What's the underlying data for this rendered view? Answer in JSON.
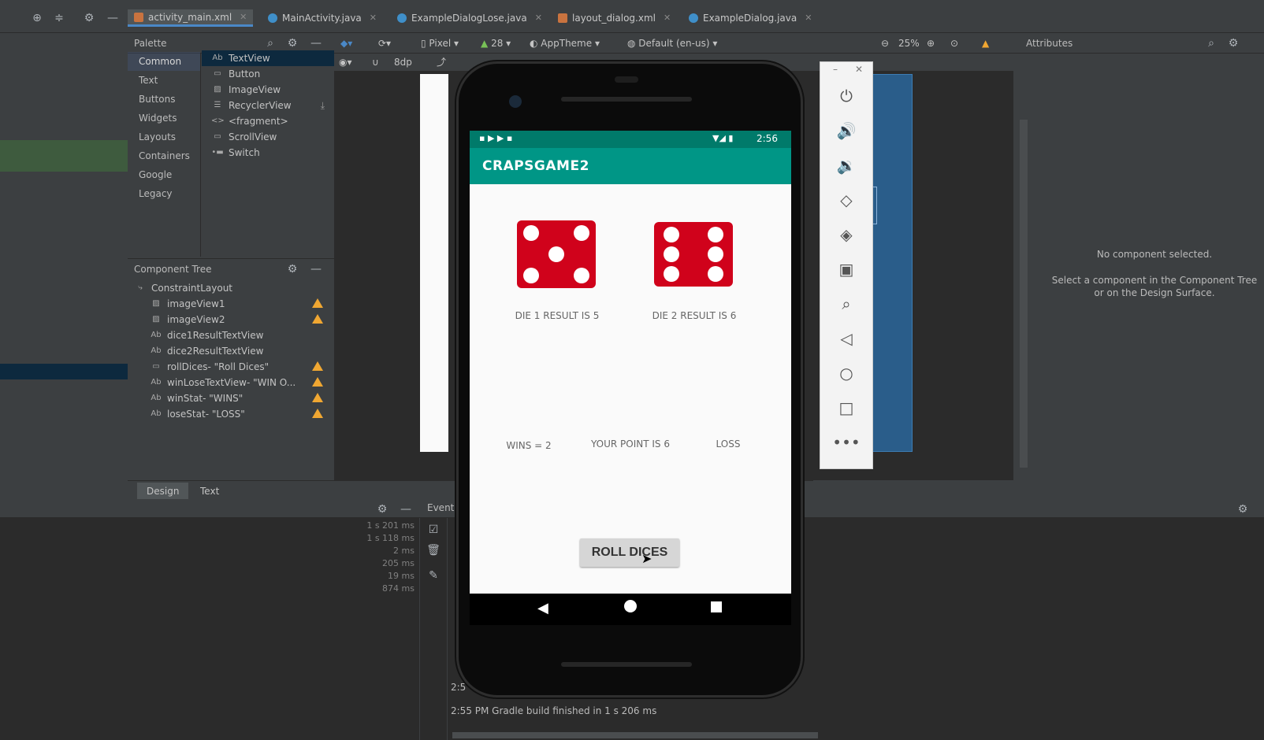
{
  "toolbar": {
    "icons": [
      "crosshair-icon",
      "collapse-icon",
      "gear-icon",
      "minimize-icon"
    ]
  },
  "tabs": [
    {
      "label": "activity_main.xml",
      "type": "xml",
      "active": true
    },
    {
      "label": "MainActivity.java",
      "type": "java",
      "active": false
    },
    {
      "label": "ExampleDialogLose.java",
      "type": "java",
      "active": false
    },
    {
      "label": "layout_dialog.xml",
      "type": "xml",
      "active": false
    },
    {
      "label": "ExampleDialog.java",
      "type": "java",
      "active": false
    }
  ],
  "palette": {
    "title": "Palette",
    "categories": [
      "Common",
      "Text",
      "Buttons",
      "Widgets",
      "Layouts",
      "Containers",
      "Google",
      "Legacy"
    ],
    "items": [
      {
        "glyph": "Ab",
        "label": "TextView"
      },
      {
        "glyph": "▭",
        "label": "Button"
      },
      {
        "glyph": "▨",
        "label": "ImageView"
      },
      {
        "glyph": "☰",
        "label": "RecyclerView"
      },
      {
        "glyph": "<>",
        "label": "<fragment>"
      },
      {
        "glyph": "▭",
        "label": "ScrollView"
      },
      {
        "glyph": "•▬",
        "label": "Switch"
      }
    ]
  },
  "design_toolbar": {
    "device": "Pixel",
    "api": "28",
    "theme": "AppTheme",
    "locale": "Default (en-us)",
    "zoom": "25%",
    "margin": "8dp"
  },
  "component_tree": {
    "title": "Component Tree",
    "root": "ConstraintLayout",
    "items": [
      {
        "glyph": "▨",
        "label": "imageView1",
        "warn": true
      },
      {
        "glyph": "▨",
        "label": "imageView2",
        "warn": true
      },
      {
        "glyph": "Ab",
        "label": "dice1ResultTextView",
        "warn": false
      },
      {
        "glyph": "Ab",
        "label": "dice2ResultTextView",
        "warn": false
      },
      {
        "glyph": "▭",
        "label": "rollDices- \"Roll Dices\"",
        "warn": true
      },
      {
        "glyph": "Ab",
        "label": "winLoseTextView- \"WIN O...",
        "warn": true
      },
      {
        "glyph": "Ab",
        "label": "winStat- \"WINS\"",
        "warn": true
      },
      {
        "glyph": "Ab",
        "label": "loseStat- \"LOSS\"",
        "warn": true
      }
    ]
  },
  "attributes": {
    "title": "Attributes",
    "empty": "No component selected.",
    "hint": "Select a component in the Component Tree or on the Design Surface."
  },
  "bottom_tabs": [
    "Design",
    "Text"
  ],
  "event_log": {
    "title": "Event",
    "timings": [
      "1 s 201 ms",
      "1 s 118 ms",
      "2 ms",
      "205 ms",
      "19 ms",
      "874 ms"
    ],
    "build_message": "2:55 PM  Gradle build finished in 1 s 206 ms",
    "partial_time": "2:5"
  },
  "emulator": {
    "status_time": "2:56",
    "app_title": "CRAPSGAME2",
    "die1_label": "DIE 1 RESULT IS 5",
    "die2_label": "DIE 2 RESULT IS 6",
    "die1_value": 5,
    "die2_value": 6,
    "wins": "WINS = 2",
    "point": "YOUR POINT IS 6",
    "loss": "LOSS",
    "roll_button": "ROLL DICES",
    "accent": "#009686",
    "die_color": "#d0021b"
  },
  "emulator_controls": [
    "power-icon",
    "volume-up-icon",
    "volume-down-icon",
    "rotate-left-icon",
    "rotate-right-icon",
    "camera-icon",
    "zoom-icon",
    "back-icon",
    "home-icon",
    "overview-icon",
    "more-icon"
  ]
}
